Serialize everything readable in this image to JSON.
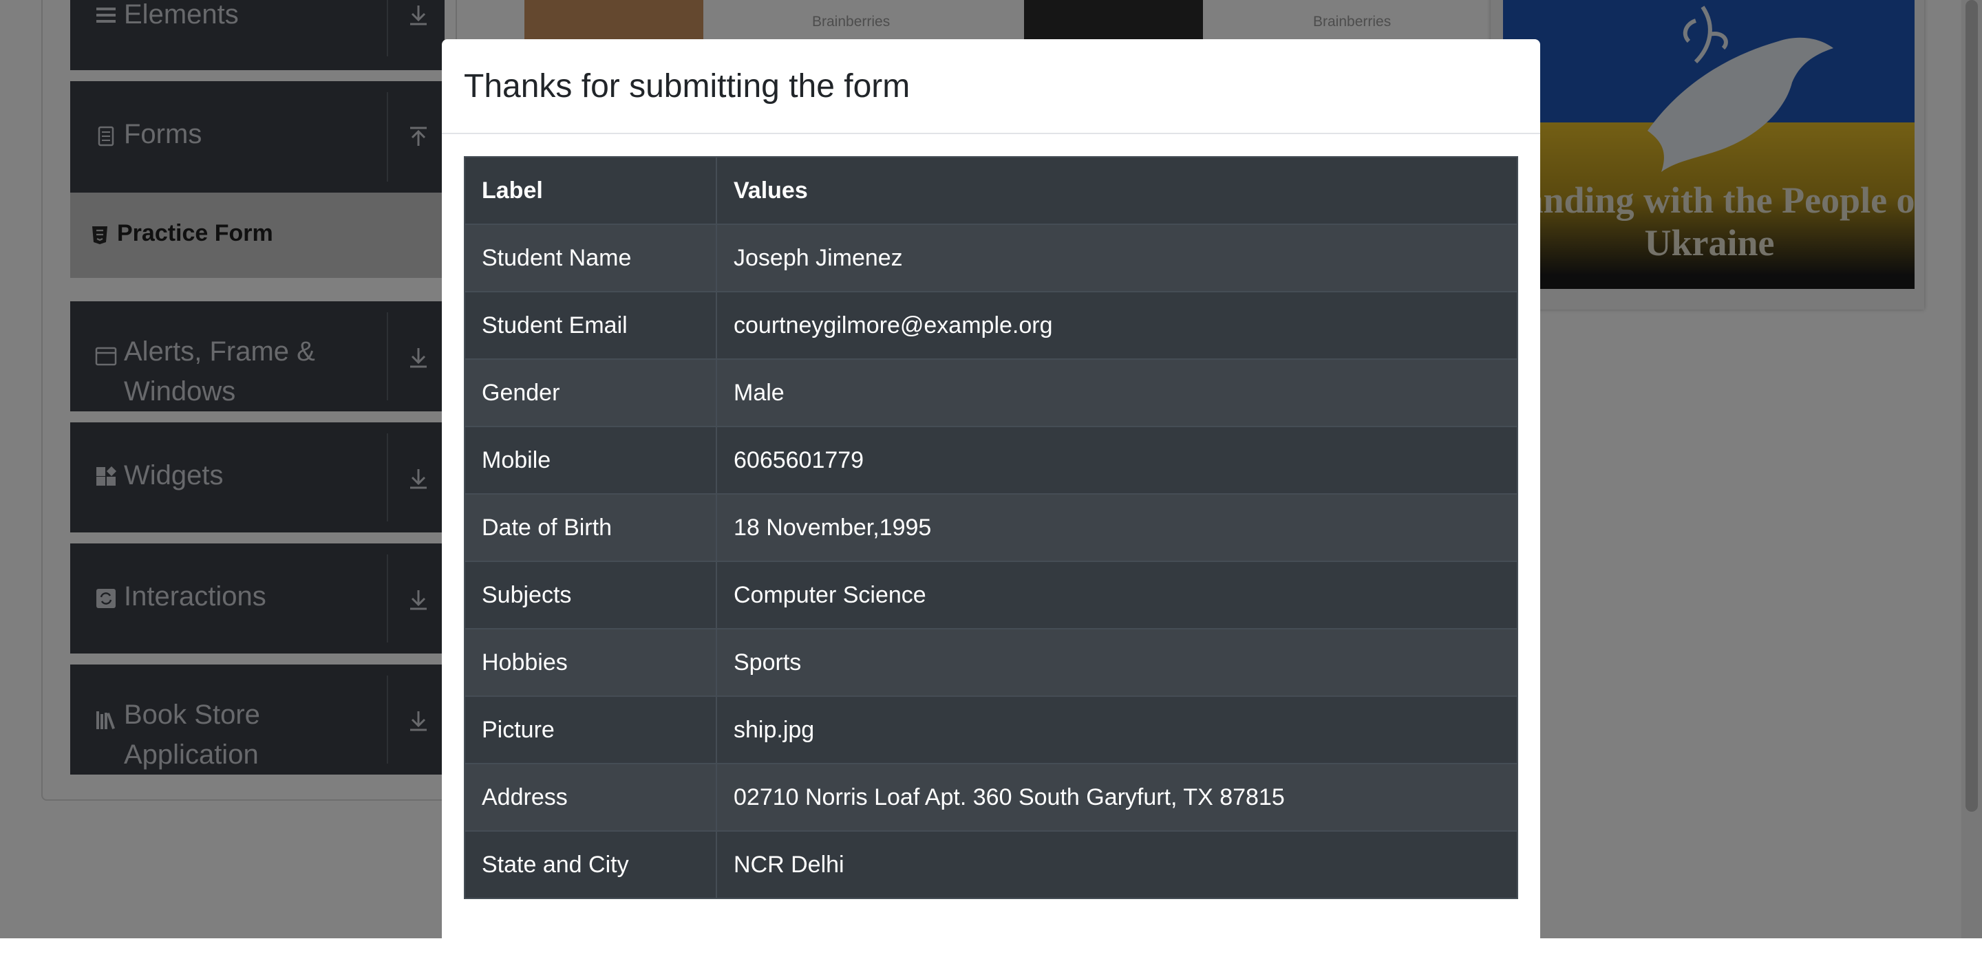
{
  "sidebar": {
    "groups": [
      {
        "label": "Elements",
        "icon": "menu-icon",
        "arrow": "download-icon"
      },
      {
        "label": "Forms",
        "icon": "form-icon",
        "arrow": "upload-icon"
      },
      {
        "label": "Alerts, Frame & Windows",
        "icon": "window-icon",
        "arrow": "download-icon"
      },
      {
        "label": "Widgets",
        "icon": "widgets-icon",
        "arrow": "download-icon"
      },
      {
        "label": "Interactions",
        "icon": "interactions-icon",
        "arrow": "download-icon"
      },
      {
        "label": "Book Store Application",
        "icon": "books-icon",
        "arrow": "download-icon"
      }
    ],
    "active_item": {
      "label": "Practice Form",
      "icon": "html5-icon"
    }
  },
  "ads": {
    "brand_1": "Brainberries",
    "brand_2": "Brainberries",
    "banner_text": "Standing with the People of Ukraine"
  },
  "modal": {
    "title": "Thanks for submitting the form",
    "table": {
      "headers": [
        "Label",
        "Values"
      ],
      "rows": [
        [
          "Student Name",
          "Joseph Jimenez"
        ],
        [
          "Student Email",
          "courtneygilmore@example.org"
        ],
        [
          "Gender",
          "Male"
        ],
        [
          "Mobile",
          "6065601779"
        ],
        [
          "Date of Birth",
          "18 November,1995"
        ],
        [
          "Subjects",
          "Computer Science"
        ],
        [
          "Hobbies",
          "Sports"
        ],
        [
          "Picture",
          "ship.jpg"
        ],
        [
          "Address",
          "02710 Norris Loaf Apt. 360 South Garyfurt, TX 87815"
        ],
        [
          "State and City",
          "NCR Delhi"
        ]
      ]
    }
  },
  "colors": {
    "sidebar_group": "#3c4048",
    "table_dark": "#343a40",
    "table_light": "#3e444a",
    "ukraine_blue": "#1f57b8",
    "ukraine_yellow": "#e8bf2a"
  }
}
